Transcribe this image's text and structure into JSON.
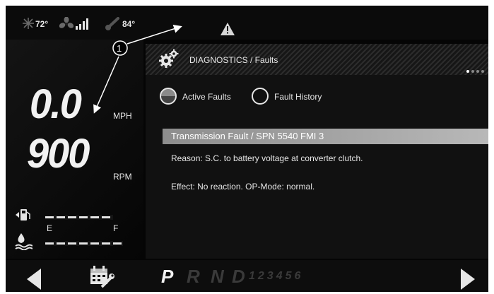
{
  "status": {
    "inside_temp": "72°",
    "outside_temp": "84°",
    "icons": [
      "snowflake-icon",
      "fan-icon",
      "signal-bars-icon",
      "thermometer-icon",
      "warning-icon"
    ]
  },
  "speed": {
    "value": "0.0",
    "unit": "MPH"
  },
  "rpm": {
    "value": "900",
    "unit": "RPM"
  },
  "gauges": {
    "fuel_empty": "E",
    "fuel_full": "F"
  },
  "header": {
    "title": "DIAGNOSTICS / Faults",
    "page_indicator": {
      "count": 4,
      "active": 1
    }
  },
  "tabs": [
    {
      "label": "Active Faults",
      "selected": true
    },
    {
      "label": "Fault History",
      "selected": false
    }
  ],
  "fault": {
    "title": "Transmission Fault / SPN 5540 FMI 3",
    "reason": "Reason: S.C. to battery voltage at converter clutch.",
    "effect": "Effect: No reaction. OP-Mode: normal."
  },
  "gear_selector": {
    "letters": [
      "P",
      "R",
      "N",
      "D"
    ],
    "selected": "P",
    "numbers": "123456"
  },
  "callout": {
    "number": "1"
  },
  "colors": {
    "background": "#050505",
    "text": "#e6e6e6",
    "fault_bar": "#a8a8a8"
  }
}
